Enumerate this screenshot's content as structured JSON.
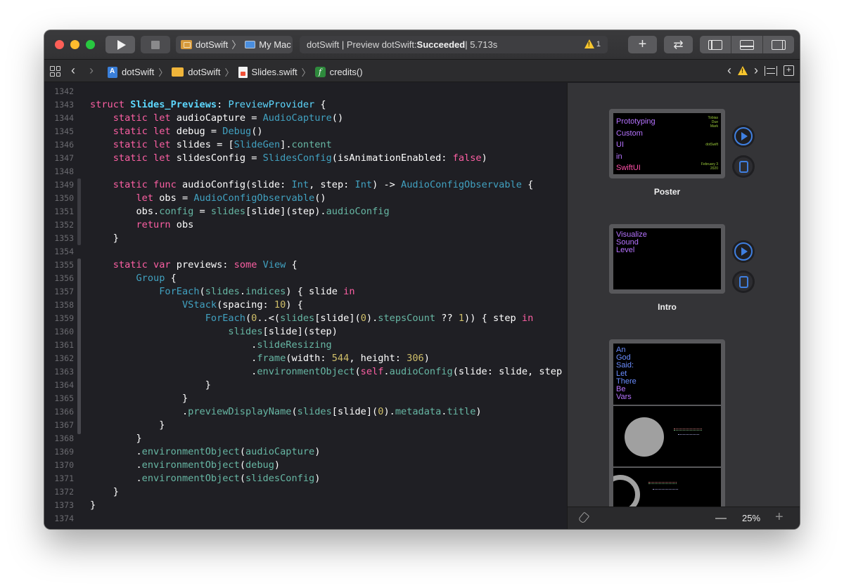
{
  "colors": {
    "accent": "#3f7fe0",
    "warning": "#f7c52e",
    "editor_bg": "#1f1f24",
    "keyword": "#fc5fa3",
    "type": "#5dd8ff",
    "number": "#d0bf69"
  },
  "toolbar": {
    "scheme_target": "dotSwift",
    "scheme_device": "My Mac",
    "status_prefix": "dotSwift | Preview dotSwift: ",
    "status_result": "Succeeded",
    "status_time": " | 5.713s",
    "warning_count": "1",
    "plus_label": "+",
    "swap_label": "⇄"
  },
  "jumpbar": {
    "back": "‹",
    "forward": "›",
    "crumbs": [
      "dotSwift",
      "dotSwift",
      "Slides.swift",
      "credits()"
    ],
    "sep": "〉",
    "func_icon": "f"
  },
  "editor": {
    "line_numbers": [
      "1342",
      "1343",
      "1344",
      "1345",
      "1346",
      "1347",
      "1348",
      "1349",
      "1350",
      "1351",
      "1352",
      "1353",
      "1354",
      "1355",
      "1356",
      "1357",
      "1358",
      "1359",
      "1360",
      "1361",
      "1362",
      "1363",
      "1364",
      "1365",
      "1366",
      "1367",
      "1368",
      "1369",
      "1370",
      "1371",
      "1372",
      "1373",
      "1374"
    ],
    "tok": {
      "struct": "struct",
      "slides_previews": "Slides_Previews",
      "colon_sp": ": ",
      "preview_provider": "PreviewProvider",
      "open_brace": " {",
      "static": "static",
      "let": "let",
      "var": "var",
      "func": "func",
      "return": "return",
      "some": "some",
      "in": "in",
      "self": "self",
      "false": "false",
      "audioCapture": "audioCapture",
      "debug": "debug",
      "slides": "slides",
      "slidesConfig": "slidesConfig",
      "eq": " = ",
      "AudioCapture": "AudioCapture",
      "Debug": "Debug",
      "parens": "()",
      "SlideGen": "SlideGen",
      "content": "content",
      "SlidesConfig": "SlidesConfig",
      "isAnimationEnabled": "(isAnimationEnabled: ",
      "audioConfig": "audioConfig",
      "slide_param": "(slide: ",
      "Int": "Int",
      "step_param": ", step: ",
      "arrow": ") -> ",
      "AudioConfigObservable": "AudioConfigObservable",
      "obs": "obs",
      "config": "config",
      "previews": "previews",
      "View": "View",
      "Group": "Group",
      "ForEach": "ForEach",
      "indices": "indices",
      "slide_in": ") { slide ",
      "VStack": "VStack",
      "spacing": "(spacing: ",
      "num_10": "10",
      "num_0": "0",
      "num_1": "1",
      "num_544": "544",
      "num_306": "306",
      "range_open": "(",
      "range_op": "..<(",
      "stepsCount": "stepsCount",
      "nil_coal": " ?? ",
      "step_in": ")) { step ",
      "slide_step": "[slide](step)",
      "slideResizing": "slideResizing",
      "frame": "frame",
      "width_lbl": "(width: ",
      "height_lbl": ", height: ",
      "environmentObject": "environmentObject",
      "slide_slide_step": "(slide: slide, step",
      "previewDisplayName": "previewDisplayName",
      "metadata": "metadata",
      "title": "title",
      "close_brace": "}",
      "dot": ".",
      "lbrack": "[",
      "rbrack": "]",
      "slide_idx": "[slide](",
      "paren_close": ")",
      "open_paren": "("
    }
  },
  "canvas": {
    "previews": [
      {
        "label": "Poster",
        "words": [
          "Prototyping",
          "Custom",
          "UI",
          "in",
          "SwiftUI"
        ],
        "meta_top": "Tobias\nDue\nMark",
        "meta_mid": "dotSwift",
        "meta_bottom": "February 3\n2020"
      },
      {
        "label": "Intro",
        "words": [
          "Visualize",
          "Sound",
          "Level"
        ]
      },
      {
        "label": "",
        "words": [
          "An",
          "God",
          "Said:",
          "Let",
          "There",
          "Be",
          "Vars"
        ]
      }
    ],
    "zoom": "25%",
    "zoom_minus": "—",
    "zoom_plus": "+"
  }
}
